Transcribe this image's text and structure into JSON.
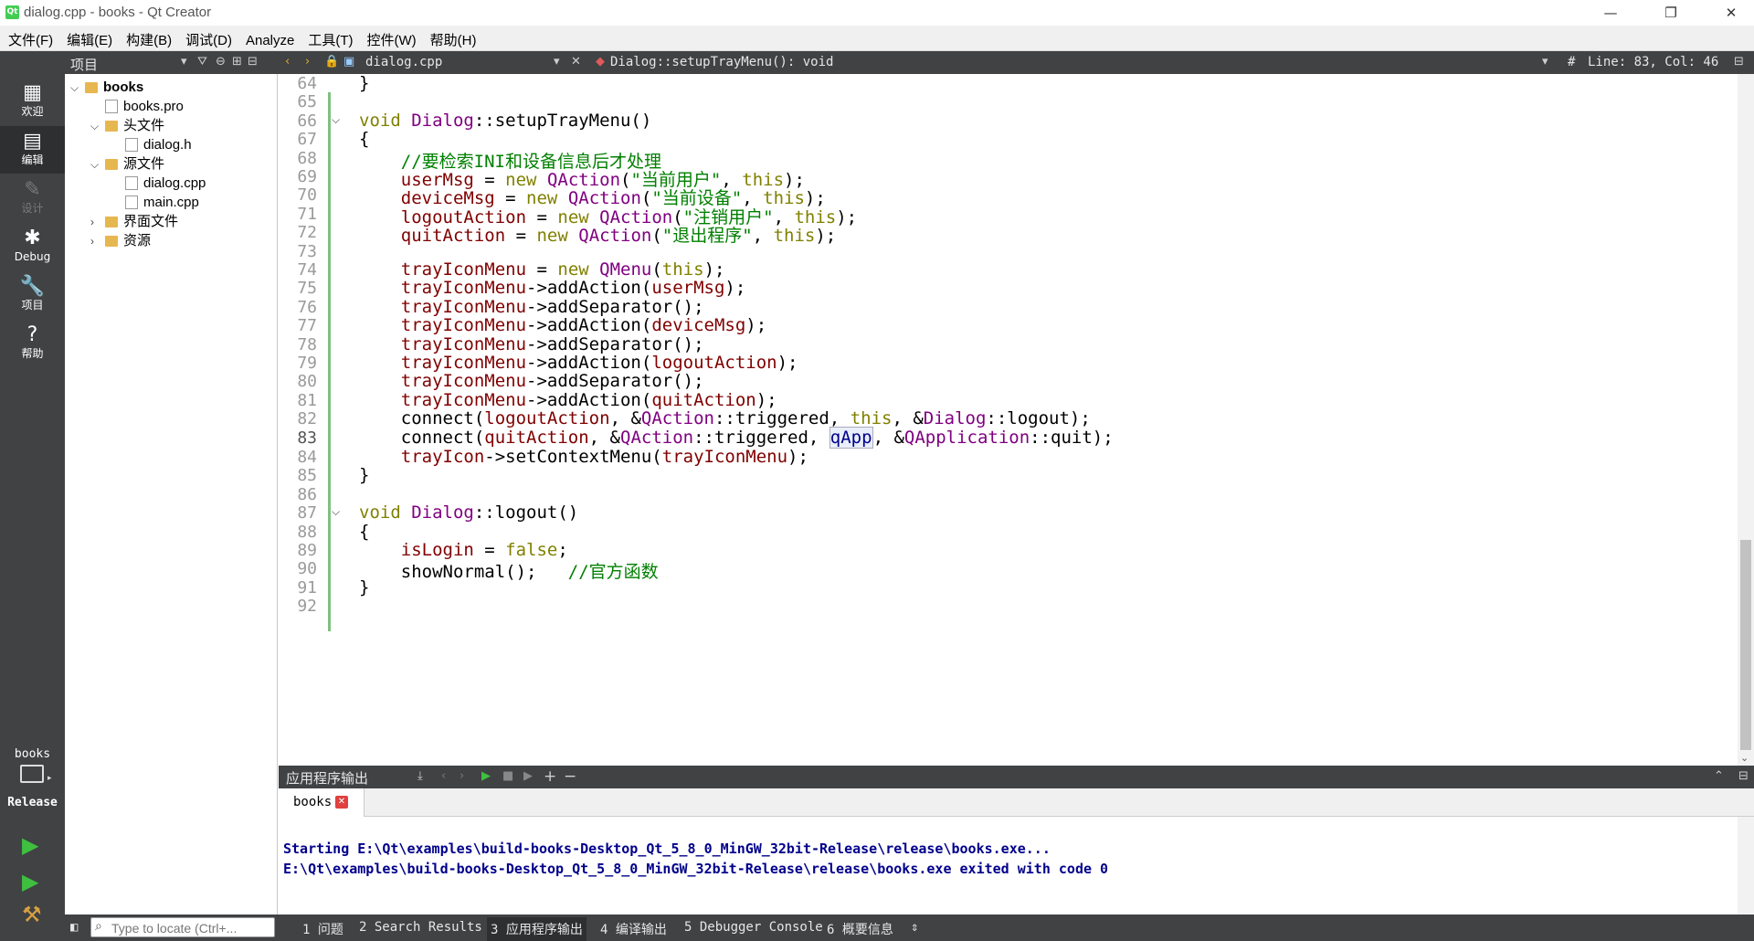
{
  "window": {
    "title": "dialog.cpp - books - Qt Creator",
    "app_icon": "Qt",
    "controls": {
      "minimize": "—",
      "maximize": "❐",
      "close": "✕"
    }
  },
  "menubar": {
    "items": [
      "文件(F)",
      "编辑(E)",
      "构建(B)",
      "调试(D)",
      "Analyze",
      "工具(T)",
      "控件(W)",
      "帮助(H)"
    ]
  },
  "toolbar": {
    "project_pane_title": "项目",
    "open_file": "dialog.cpp",
    "symbol": "Dialog::setupTrayMenu(): void",
    "hash": "#",
    "cursor_pos": "Line: 83, Col: 46"
  },
  "modes": [
    {
      "label": "欢迎",
      "icon": "grid-icon",
      "glyph": "▦",
      "active": false,
      "enabled": true
    },
    {
      "label": "编辑",
      "icon": "edit-icon",
      "glyph": "▤",
      "active": true,
      "enabled": true
    },
    {
      "label": "设计",
      "icon": "design-icon",
      "glyph": "✎",
      "active": false,
      "enabled": false
    },
    {
      "label": "Debug",
      "icon": "bug-icon",
      "glyph": "✱",
      "active": false,
      "enabled": true
    },
    {
      "label": "项目",
      "icon": "wrench-icon",
      "glyph": "🔧",
      "active": false,
      "enabled": true
    },
    {
      "label": "帮助",
      "icon": "help-icon",
      "glyph": "?",
      "active": false,
      "enabled": true
    }
  ],
  "kit": {
    "project": "books",
    "config": "Release"
  },
  "tree": [
    {
      "label": "books",
      "depth": 0,
      "arrow": "⌵",
      "type": "project",
      "bold": true
    },
    {
      "label": "books.pro",
      "depth": 1,
      "arrow": "",
      "type": "file"
    },
    {
      "label": "头文件",
      "depth": 1,
      "arrow": "⌵",
      "type": "folder"
    },
    {
      "label": "dialog.h",
      "depth": 2,
      "arrow": "",
      "type": "file"
    },
    {
      "label": "源文件",
      "depth": 1,
      "arrow": "⌵",
      "type": "folder"
    },
    {
      "label": "dialog.cpp",
      "depth": 2,
      "arrow": "",
      "type": "file"
    },
    {
      "label": "main.cpp",
      "depth": 2,
      "arrow": "",
      "type": "file"
    },
    {
      "label": "界面文件",
      "depth": 1,
      "arrow": "›",
      "type": "folder"
    },
    {
      "label": "资源",
      "depth": 1,
      "arrow": "›",
      "type": "folder"
    }
  ],
  "editor": {
    "current_line": 83,
    "lines": [
      {
        "n": "64",
        "t": [
          [
            "}",
            ""
          ]
        ]
      },
      {
        "n": "65",
        "t": []
      },
      {
        "n": "66",
        "fold": true,
        "t": [
          [
            "void ",
            "kw"
          ],
          [
            "Dialog",
            "cls"
          ],
          [
            "::setupTrayMenu()",
            ""
          ]
        ]
      },
      {
        "n": "67",
        "t": [
          [
            "{",
            ""
          ]
        ]
      },
      {
        "n": "68",
        "t": [
          [
            "    //要检索INI和设备信息后才处理",
            "cm"
          ]
        ]
      },
      {
        "n": "69",
        "t": [
          [
            "    ",
            ""
          ],
          [
            "userMsg",
            "mem"
          ],
          [
            " = ",
            ""
          ],
          [
            "new ",
            "kw"
          ],
          [
            "QAction",
            "cls"
          ],
          [
            "(",
            ""
          ],
          [
            "\"当前用户\"",
            "str"
          ],
          [
            ", ",
            ""
          ],
          [
            "this",
            "kw"
          ],
          [
            ");",
            ""
          ]
        ]
      },
      {
        "n": "70",
        "t": [
          [
            "    ",
            ""
          ],
          [
            "deviceMsg",
            "mem"
          ],
          [
            " = ",
            ""
          ],
          [
            "new ",
            "kw"
          ],
          [
            "QAction",
            "cls"
          ],
          [
            "(",
            ""
          ],
          [
            "\"当前设备\"",
            "str"
          ],
          [
            ", ",
            ""
          ],
          [
            "this",
            "kw"
          ],
          [
            ");",
            ""
          ]
        ]
      },
      {
        "n": "71",
        "t": [
          [
            "    ",
            ""
          ],
          [
            "logoutAction",
            "mem"
          ],
          [
            " = ",
            ""
          ],
          [
            "new ",
            "kw"
          ],
          [
            "QAction",
            "cls"
          ],
          [
            "(",
            ""
          ],
          [
            "\"注销用户\"",
            "str"
          ],
          [
            ", ",
            ""
          ],
          [
            "this",
            "kw"
          ],
          [
            ");",
            ""
          ]
        ]
      },
      {
        "n": "72",
        "t": [
          [
            "    ",
            ""
          ],
          [
            "quitAction",
            "mem"
          ],
          [
            " = ",
            ""
          ],
          [
            "new ",
            "kw"
          ],
          [
            "QAction",
            "cls"
          ],
          [
            "(",
            ""
          ],
          [
            "\"退出程序\"",
            "str"
          ],
          [
            ", ",
            ""
          ],
          [
            "this",
            "kw"
          ],
          [
            ");",
            ""
          ]
        ]
      },
      {
        "n": "73",
        "t": []
      },
      {
        "n": "74",
        "t": [
          [
            "    ",
            ""
          ],
          [
            "trayIconMenu",
            "mem"
          ],
          [
            " = ",
            ""
          ],
          [
            "new ",
            "kw"
          ],
          [
            "QMenu",
            "cls"
          ],
          [
            "(",
            ""
          ],
          [
            "this",
            "kw"
          ],
          [
            ");",
            ""
          ]
        ]
      },
      {
        "n": "75",
        "t": [
          [
            "    ",
            ""
          ],
          [
            "trayIconMenu",
            "mem"
          ],
          [
            "->addAction(",
            ""
          ],
          [
            "userMsg",
            "mem"
          ],
          [
            ");",
            ""
          ]
        ]
      },
      {
        "n": "76",
        "t": [
          [
            "    ",
            ""
          ],
          [
            "trayIconMenu",
            "mem"
          ],
          [
            "->addSeparator();",
            ""
          ]
        ]
      },
      {
        "n": "77",
        "t": [
          [
            "    ",
            ""
          ],
          [
            "trayIconMenu",
            "mem"
          ],
          [
            "->addAction(",
            ""
          ],
          [
            "deviceMsg",
            "mem"
          ],
          [
            ");",
            ""
          ]
        ]
      },
      {
        "n": "78",
        "t": [
          [
            "    ",
            ""
          ],
          [
            "trayIconMenu",
            "mem"
          ],
          [
            "->addSeparator();",
            ""
          ]
        ]
      },
      {
        "n": "79",
        "t": [
          [
            "    ",
            ""
          ],
          [
            "trayIconMenu",
            "mem"
          ],
          [
            "->addAction(",
            ""
          ],
          [
            "logoutAction",
            "mem"
          ],
          [
            ");",
            ""
          ]
        ]
      },
      {
        "n": "80",
        "t": [
          [
            "    ",
            ""
          ],
          [
            "trayIconMenu",
            "mem"
          ],
          [
            "->addSeparator();",
            ""
          ]
        ]
      },
      {
        "n": "81",
        "t": [
          [
            "    ",
            ""
          ],
          [
            "trayIconMenu",
            "mem"
          ],
          [
            "->addAction(",
            ""
          ],
          [
            "quitAction",
            "mem"
          ],
          [
            ");",
            ""
          ]
        ]
      },
      {
        "n": "82",
        "t": [
          [
            "    connect(",
            ""
          ],
          [
            "logoutAction",
            "mem"
          ],
          [
            ", &",
            ""
          ],
          [
            "QAction",
            "cls"
          ],
          [
            "::triggered, ",
            ""
          ],
          [
            "this",
            "kw"
          ],
          [
            ", &",
            ""
          ],
          [
            "Dialog",
            "cls"
          ],
          [
            "::logout);",
            ""
          ]
        ]
      },
      {
        "n": "83",
        "t": [
          [
            "    connect(",
            ""
          ],
          [
            "quitAction",
            "mem"
          ],
          [
            ", &",
            ""
          ],
          [
            "QAction",
            "cls"
          ],
          [
            "::triggered, ",
            ""
          ],
          [
            "qApp",
            "qapp"
          ],
          [
            ", &",
            ""
          ],
          [
            "QApplication",
            "cls"
          ],
          [
            "::quit);",
            ""
          ]
        ]
      },
      {
        "n": "84",
        "t": [
          [
            "    ",
            ""
          ],
          [
            "trayIcon",
            "mem"
          ],
          [
            "->setContextMenu(",
            ""
          ],
          [
            "trayIconMenu",
            "mem"
          ],
          [
            ");",
            ""
          ]
        ]
      },
      {
        "n": "85",
        "t": [
          [
            "}",
            ""
          ]
        ]
      },
      {
        "n": "86",
        "t": []
      },
      {
        "n": "87",
        "fold": true,
        "t": [
          [
            "void ",
            "kw"
          ],
          [
            "Dialog",
            "cls"
          ],
          [
            "::logout()",
            ""
          ]
        ]
      },
      {
        "n": "88",
        "t": [
          [
            "{",
            ""
          ]
        ]
      },
      {
        "n": "89",
        "t": [
          [
            "    ",
            ""
          ],
          [
            "isLogin",
            "mem"
          ],
          [
            " = ",
            ""
          ],
          [
            "false",
            "kw"
          ],
          [
            ";",
            ""
          ]
        ]
      },
      {
        "n": "90",
        "t": [
          [
            "    showNormal();   ",
            ""
          ],
          [
            "//官方函数",
            "cm"
          ]
        ]
      },
      {
        "n": "91",
        "t": [
          [
            "}",
            ""
          ]
        ]
      },
      {
        "n": "92",
        "t": []
      }
    ]
  },
  "output": {
    "title": "应用程序输出",
    "tab": "books",
    "lines": [
      "Starting E:\\Qt\\examples\\build-books-Desktop_Qt_5_8_0_MinGW_32bit-Release\\release\\books.exe...",
      "E:\\Qt\\examples\\build-books-Desktop_Qt_5_8_0_MinGW_32bit-Release\\release\\books.exe exited with code 0"
    ]
  },
  "statusbar": {
    "locate_placeholder": "Type to locate (Ctrl+...",
    "panes": [
      "1 问题",
      "2 Search Results",
      "3 应用程序输出",
      "4 编译输出",
      "5 Debugger Console",
      "6 概要信息"
    ]
  },
  "colors": {
    "keyword": "#808000",
    "class": "#800080",
    "string": "#008000",
    "member": "#800000",
    "chrome": "#404244"
  }
}
